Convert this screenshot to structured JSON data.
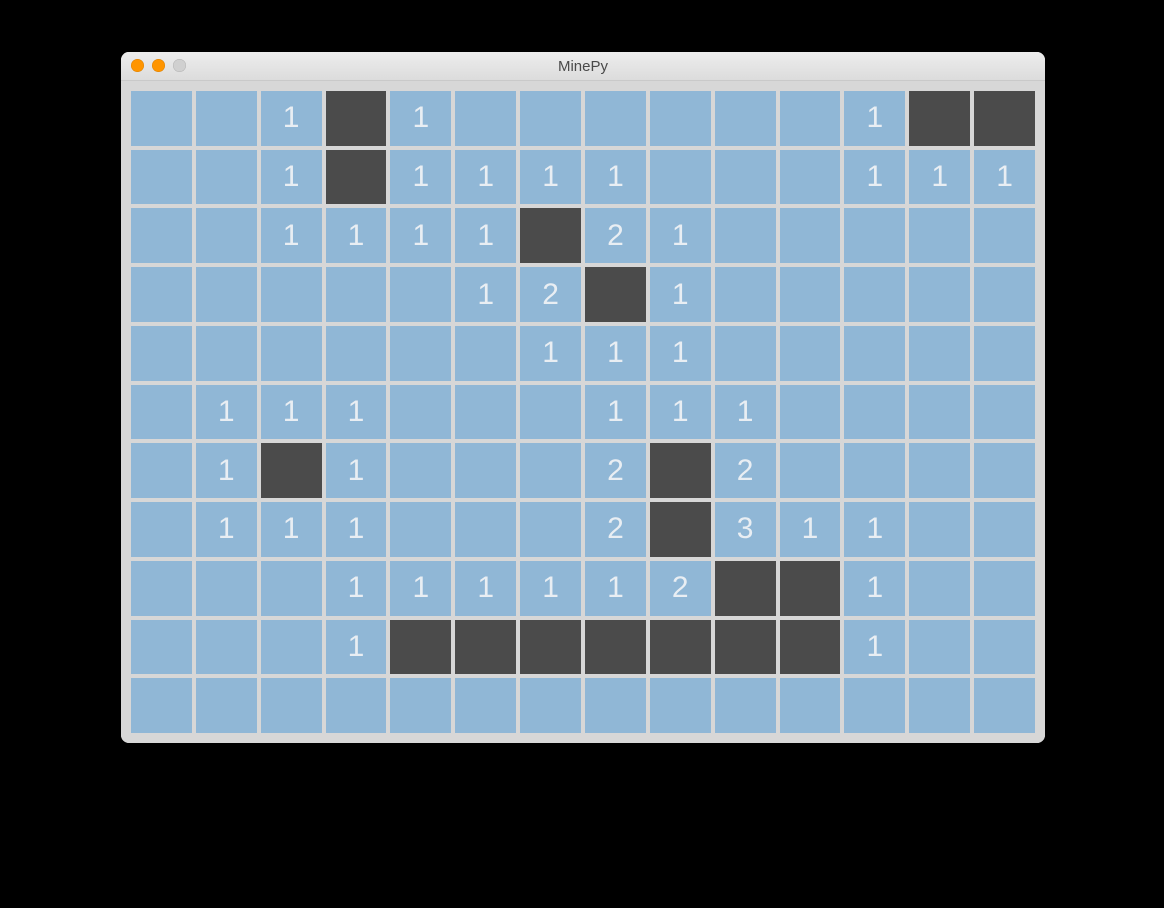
{
  "window": {
    "title": "MinePy"
  },
  "grid": {
    "cols": 14,
    "rows": 11,
    "cells": [
      [
        {
          "s": "o",
          "v": ""
        },
        {
          "s": "o",
          "v": ""
        },
        {
          "s": "o",
          "v": "1"
        },
        {
          "s": "c",
          "v": ""
        },
        {
          "s": "o",
          "v": "1"
        },
        {
          "s": "o",
          "v": ""
        },
        {
          "s": "o",
          "v": ""
        },
        {
          "s": "o",
          "v": ""
        },
        {
          "s": "o",
          "v": ""
        },
        {
          "s": "o",
          "v": ""
        },
        {
          "s": "o",
          "v": ""
        },
        {
          "s": "o",
          "v": "1"
        },
        {
          "s": "c",
          "v": ""
        },
        {
          "s": "c",
          "v": ""
        }
      ],
      [
        {
          "s": "o",
          "v": ""
        },
        {
          "s": "o",
          "v": ""
        },
        {
          "s": "o",
          "v": "1"
        },
        {
          "s": "c",
          "v": ""
        },
        {
          "s": "o",
          "v": "1"
        },
        {
          "s": "o",
          "v": "1"
        },
        {
          "s": "o",
          "v": "1"
        },
        {
          "s": "o",
          "v": "1"
        },
        {
          "s": "o",
          "v": ""
        },
        {
          "s": "o",
          "v": ""
        },
        {
          "s": "o",
          "v": ""
        },
        {
          "s": "o",
          "v": "1"
        },
        {
          "s": "o",
          "v": "1"
        },
        {
          "s": "o",
          "v": "1"
        }
      ],
      [
        {
          "s": "o",
          "v": ""
        },
        {
          "s": "o",
          "v": ""
        },
        {
          "s": "o",
          "v": "1"
        },
        {
          "s": "o",
          "v": "1"
        },
        {
          "s": "o",
          "v": "1"
        },
        {
          "s": "o",
          "v": "1"
        },
        {
          "s": "c",
          "v": ""
        },
        {
          "s": "o",
          "v": "2"
        },
        {
          "s": "o",
          "v": "1"
        },
        {
          "s": "o",
          "v": ""
        },
        {
          "s": "o",
          "v": ""
        },
        {
          "s": "o",
          "v": ""
        },
        {
          "s": "o",
          "v": ""
        },
        {
          "s": "o",
          "v": ""
        }
      ],
      [
        {
          "s": "o",
          "v": ""
        },
        {
          "s": "o",
          "v": ""
        },
        {
          "s": "o",
          "v": ""
        },
        {
          "s": "o",
          "v": ""
        },
        {
          "s": "o",
          "v": ""
        },
        {
          "s": "o",
          "v": "1"
        },
        {
          "s": "o",
          "v": "2"
        },
        {
          "s": "c",
          "v": ""
        },
        {
          "s": "o",
          "v": "1"
        },
        {
          "s": "o",
          "v": ""
        },
        {
          "s": "o",
          "v": ""
        },
        {
          "s": "o",
          "v": ""
        },
        {
          "s": "o",
          "v": ""
        },
        {
          "s": "o",
          "v": ""
        }
      ],
      [
        {
          "s": "o",
          "v": ""
        },
        {
          "s": "o",
          "v": ""
        },
        {
          "s": "o",
          "v": ""
        },
        {
          "s": "o",
          "v": ""
        },
        {
          "s": "o",
          "v": ""
        },
        {
          "s": "o",
          "v": ""
        },
        {
          "s": "o",
          "v": "1"
        },
        {
          "s": "o",
          "v": "1"
        },
        {
          "s": "o",
          "v": "1"
        },
        {
          "s": "o",
          "v": ""
        },
        {
          "s": "o",
          "v": ""
        },
        {
          "s": "o",
          "v": ""
        },
        {
          "s": "o",
          "v": ""
        },
        {
          "s": "o",
          "v": ""
        }
      ],
      [
        {
          "s": "o",
          "v": ""
        },
        {
          "s": "o",
          "v": "1"
        },
        {
          "s": "o",
          "v": "1"
        },
        {
          "s": "o",
          "v": "1"
        },
        {
          "s": "o",
          "v": ""
        },
        {
          "s": "o",
          "v": ""
        },
        {
          "s": "o",
          "v": ""
        },
        {
          "s": "o",
          "v": "1"
        },
        {
          "s": "o",
          "v": "1"
        },
        {
          "s": "o",
          "v": "1"
        },
        {
          "s": "o",
          "v": ""
        },
        {
          "s": "o",
          "v": ""
        },
        {
          "s": "o",
          "v": ""
        },
        {
          "s": "o",
          "v": ""
        }
      ],
      [
        {
          "s": "o",
          "v": ""
        },
        {
          "s": "o",
          "v": "1"
        },
        {
          "s": "c",
          "v": ""
        },
        {
          "s": "o",
          "v": "1"
        },
        {
          "s": "o",
          "v": ""
        },
        {
          "s": "o",
          "v": ""
        },
        {
          "s": "o",
          "v": ""
        },
        {
          "s": "o",
          "v": "2"
        },
        {
          "s": "c",
          "v": ""
        },
        {
          "s": "o",
          "v": "2"
        },
        {
          "s": "o",
          "v": ""
        },
        {
          "s": "o",
          "v": ""
        },
        {
          "s": "o",
          "v": ""
        },
        {
          "s": "o",
          "v": ""
        }
      ],
      [
        {
          "s": "o",
          "v": ""
        },
        {
          "s": "o",
          "v": "1"
        },
        {
          "s": "o",
          "v": "1"
        },
        {
          "s": "o",
          "v": "1"
        },
        {
          "s": "o",
          "v": ""
        },
        {
          "s": "o",
          "v": ""
        },
        {
          "s": "o",
          "v": ""
        },
        {
          "s": "o",
          "v": "2"
        },
        {
          "s": "c",
          "v": ""
        },
        {
          "s": "o",
          "v": "3"
        },
        {
          "s": "o",
          "v": "1"
        },
        {
          "s": "o",
          "v": "1"
        },
        {
          "s": "o",
          "v": ""
        },
        {
          "s": "o",
          "v": ""
        }
      ],
      [
        {
          "s": "o",
          "v": ""
        },
        {
          "s": "o",
          "v": ""
        },
        {
          "s": "o",
          "v": ""
        },
        {
          "s": "o",
          "v": "1"
        },
        {
          "s": "o",
          "v": "1"
        },
        {
          "s": "o",
          "v": "1"
        },
        {
          "s": "o",
          "v": "1"
        },
        {
          "s": "o",
          "v": "1"
        },
        {
          "s": "o",
          "v": "2"
        },
        {
          "s": "c",
          "v": ""
        },
        {
          "s": "c",
          "v": ""
        },
        {
          "s": "o",
          "v": "1"
        },
        {
          "s": "o",
          "v": ""
        },
        {
          "s": "o",
          "v": ""
        }
      ],
      [
        {
          "s": "o",
          "v": ""
        },
        {
          "s": "o",
          "v": ""
        },
        {
          "s": "o",
          "v": ""
        },
        {
          "s": "o",
          "v": "1"
        },
        {
          "s": "c",
          "v": ""
        },
        {
          "s": "c",
          "v": ""
        },
        {
          "s": "c",
          "v": ""
        },
        {
          "s": "c",
          "v": ""
        },
        {
          "s": "c",
          "v": ""
        },
        {
          "s": "c",
          "v": ""
        },
        {
          "s": "c",
          "v": ""
        },
        {
          "s": "o",
          "v": "1"
        },
        {
          "s": "o",
          "v": ""
        },
        {
          "s": "o",
          "v": ""
        }
      ],
      [
        {
          "s": "o",
          "v": ""
        },
        {
          "s": "o",
          "v": ""
        },
        {
          "s": "o",
          "v": ""
        },
        {
          "s": "o",
          "v": ""
        },
        {
          "s": "o",
          "v": ""
        },
        {
          "s": "o",
          "v": ""
        },
        {
          "s": "o",
          "v": ""
        },
        {
          "s": "o",
          "v": ""
        },
        {
          "s": "o",
          "v": ""
        },
        {
          "s": "o",
          "v": ""
        },
        {
          "s": "o",
          "v": ""
        },
        {
          "s": "o",
          "v": ""
        },
        {
          "s": "o",
          "v": ""
        },
        {
          "s": "o",
          "v": ""
        }
      ]
    ]
  },
  "colors": {
    "open_cell": "#90b7d6",
    "closed_cell": "#4b4b4b",
    "number_text": "#e9eef3",
    "grid_bg": "#d7d7d7"
  }
}
